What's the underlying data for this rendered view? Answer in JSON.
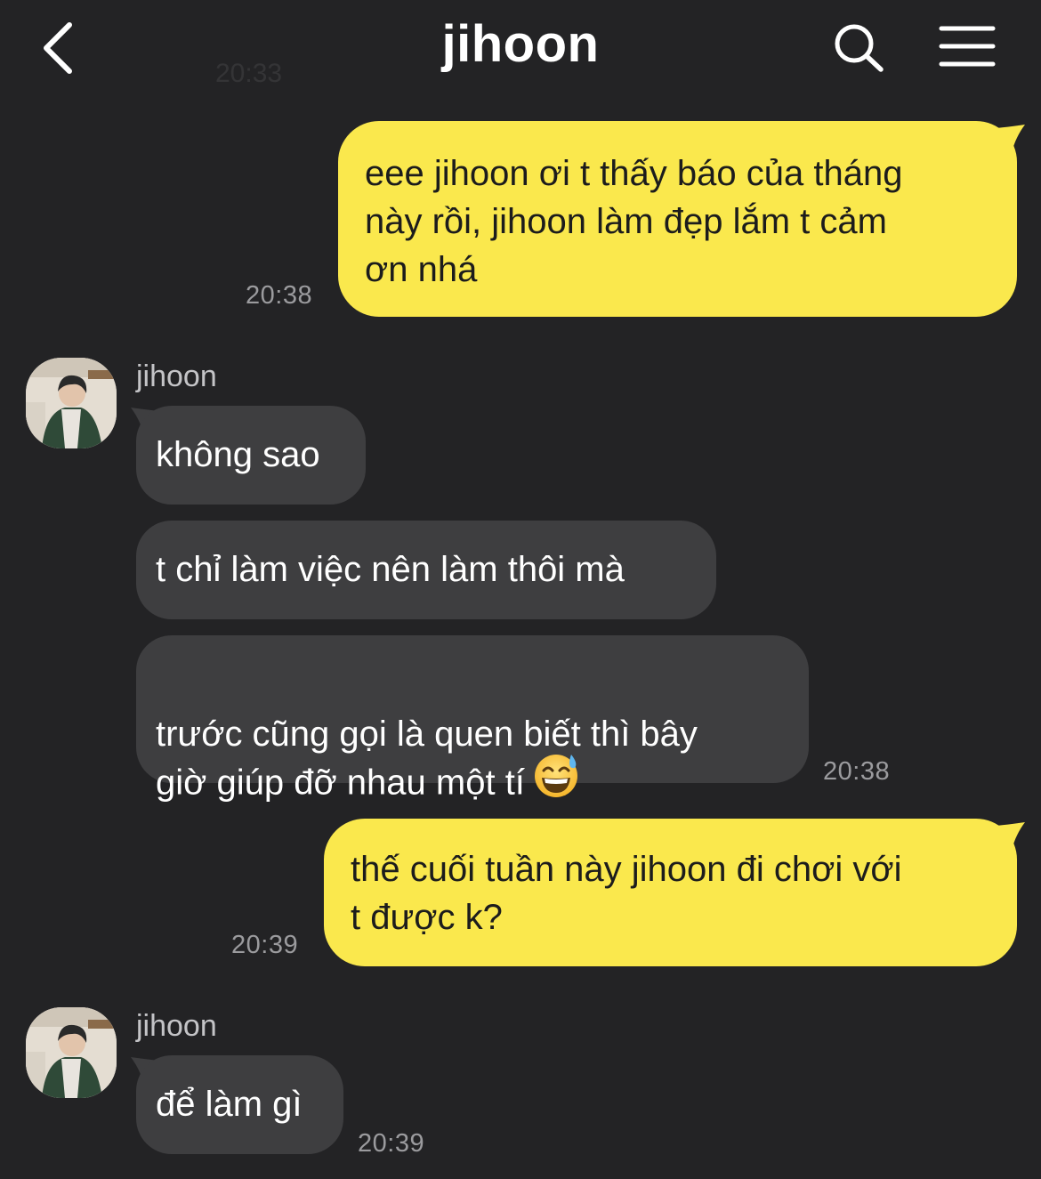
{
  "header": {
    "title": "jihoon",
    "ghost_time": "20:33"
  },
  "colors": {
    "background": "#232325",
    "outgoing_bubble": "#fae84d",
    "incoming_bubble": "#3e3e40"
  },
  "messages": [
    {
      "direction": "out",
      "text": "eee jihoon ơi t thấy báo của tháng\nnày rồi, jihoon làm đẹp lắm t cảm\nơn nhá",
      "time": "20:38"
    },
    {
      "direction": "in",
      "sender": "jihoon",
      "text": "không sao"
    },
    {
      "direction": "in",
      "text": "t chỉ làm việc nên làm thôi mà"
    },
    {
      "direction": "in",
      "text": "trước cũng gọi là quen biết thì bây\ngiờ giúp đỡ nhau một tí",
      "emoji": "sweat-smile-emoji",
      "time": "20:38"
    },
    {
      "direction": "out",
      "text": "thế cuối tuần này jihoon đi chơi với\nt được k?",
      "time": "20:39"
    },
    {
      "direction": "in",
      "sender": "jihoon",
      "text": "để làm gì",
      "time": "20:39"
    }
  ]
}
